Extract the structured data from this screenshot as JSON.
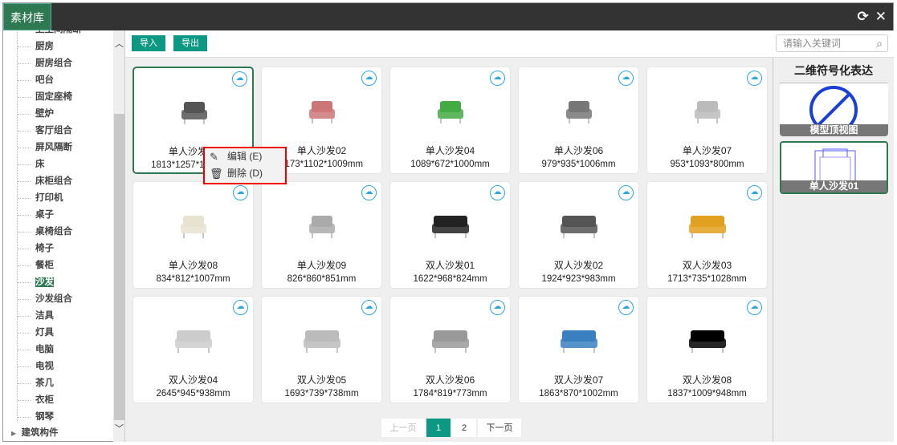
{
  "window": {
    "tab": "素材库",
    "refresh_icon": "⟳",
    "close_icon": "✕"
  },
  "sidebar": {
    "items": [
      "卫生间隔断",
      "厨房",
      "厨房组合",
      "吧台",
      "固定座椅",
      "壁炉",
      "客厅组合",
      "屏风隔断",
      "床",
      "床柜组合",
      "打印机",
      "桌子",
      "桌椅组合",
      "椅子",
      "餐柜",
      "沙发",
      "沙发组合",
      "洁具",
      "灯具",
      "电脑",
      "电视",
      "茶几",
      "衣柜",
      "钢琴"
    ],
    "selected": "沙发",
    "root": "建筑构件"
  },
  "toolbar": {
    "import": "导入",
    "export": "导出",
    "search_placeholder": "请输入关键词"
  },
  "cards": [
    {
      "name": "单人沙发01",
      "dims": "1813*1257*1000mm",
      "color": "#555"
    },
    {
      "name": "单人沙发02",
      "dims": "1173*1102*1009mm",
      "color": "#c77"
    },
    {
      "name": "单人沙发04",
      "dims": "1089*672*1000mm",
      "color": "#4a4"
    },
    {
      "name": "单人沙发06",
      "dims": "979*935*1006mm",
      "color": "#777"
    },
    {
      "name": "单人沙发07",
      "dims": "953*1093*800mm",
      "color": "#bbb"
    },
    {
      "name": "单人沙发08",
      "dims": "834*812*1007mm",
      "color": "#e8e2d0"
    },
    {
      "name": "单人沙发09",
      "dims": "826*860*851mm",
      "color": "#aaa"
    },
    {
      "name": "双人沙发01",
      "dims": "1622*968*824mm",
      "color": "#222"
    },
    {
      "name": "双人沙发02",
      "dims": "1924*923*983mm",
      "color": "#555"
    },
    {
      "name": "双人沙发03",
      "dims": "1713*735*1028mm",
      "color": "#e0a020"
    },
    {
      "name": "双人沙发04",
      "dims": "2645*945*938mm",
      "color": "#ccc"
    },
    {
      "name": "双人沙发05",
      "dims": "1693*739*738mm",
      "color": "#bbb"
    },
    {
      "name": "双人沙发06",
      "dims": "1784*819*773mm",
      "color": "#999"
    },
    {
      "name": "双人沙发07",
      "dims": "1863*870*1002mm",
      "color": "#3a7fc0"
    },
    {
      "name": "双人沙发08",
      "dims": "1837*1009*948mm",
      "color": "#000"
    }
  ],
  "context_menu": {
    "edit": "编辑 (E)",
    "delete": "删除 (D)"
  },
  "pager": {
    "prev": "上一页",
    "pages": [
      "1",
      "2"
    ],
    "current": "1",
    "next": "下一页"
  },
  "right_panel": {
    "title": "二维符号化表达",
    "items": [
      "模型顶视图",
      "单人沙发01"
    ]
  },
  "colors": {
    "accent": "#0d9883",
    "tab": "#2e7852",
    "cloud": "#2ea6e6"
  }
}
